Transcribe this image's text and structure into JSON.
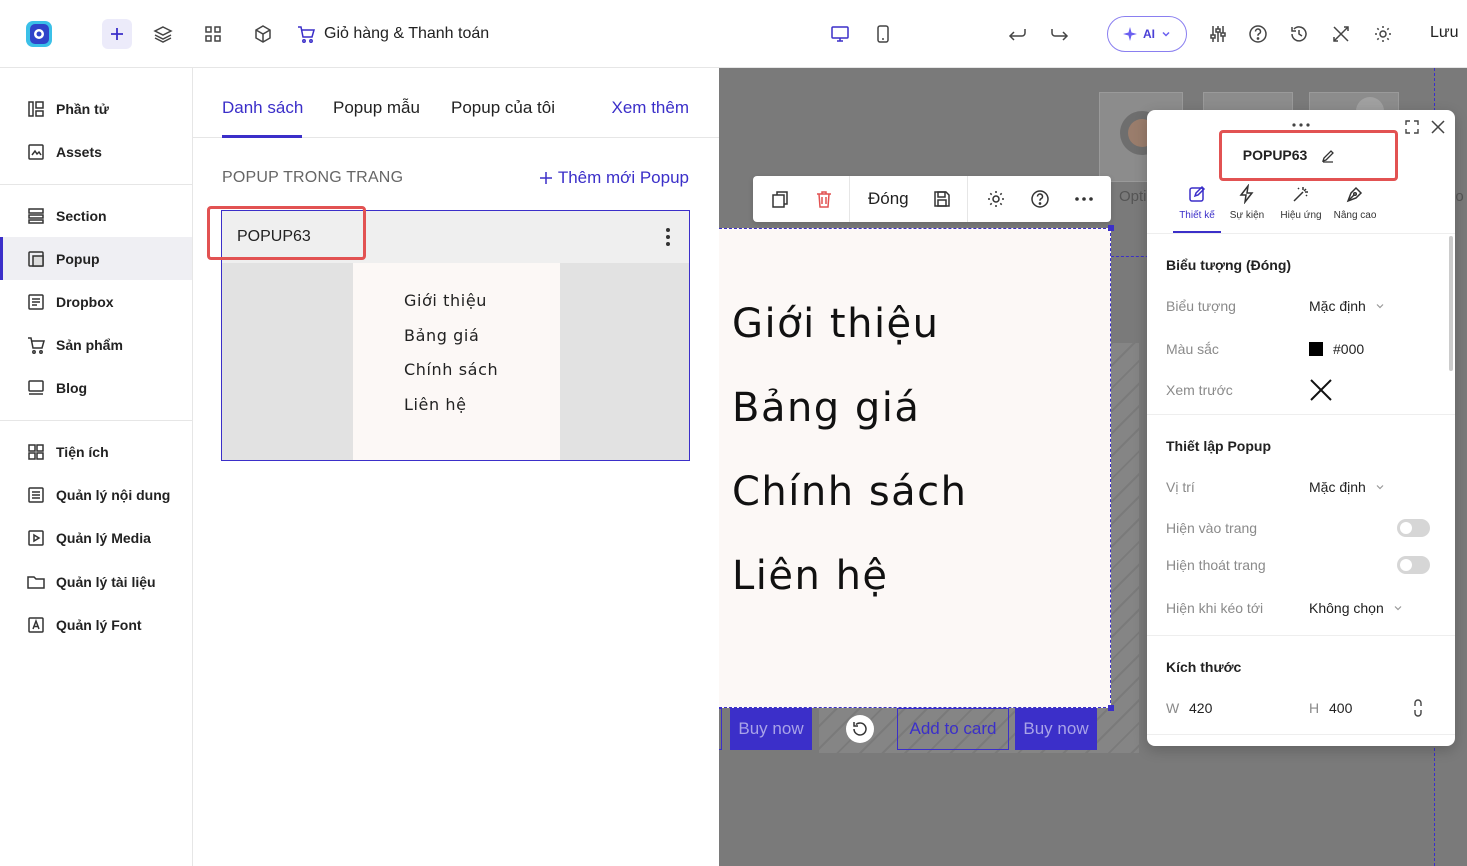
{
  "topbar": {
    "page_name": "Giỏ hàng & Thanh toán",
    "ai_label": "AI",
    "save_label": "Lưu"
  },
  "sidebar": {
    "items": [
      {
        "label": "Phần tử",
        "icon": "elements-icon"
      },
      {
        "label": "Assets",
        "icon": "assets-icon"
      },
      {
        "label": "Section",
        "icon": "section-icon"
      },
      {
        "label": "Popup",
        "icon": "popup-icon",
        "active": true
      },
      {
        "label": "Dropbox",
        "icon": "dropbox-icon"
      },
      {
        "label": "Sản phẩm",
        "icon": "cart-icon"
      },
      {
        "label": "Blog",
        "icon": "blog-icon"
      },
      {
        "label": "Tiện ích",
        "icon": "widgets-icon"
      },
      {
        "label": "Quản lý nội dung",
        "icon": "content-icon"
      },
      {
        "label": "Quản lý Media",
        "icon": "media-icon"
      },
      {
        "label": "Quản lý tài liệu",
        "icon": "folder-icon"
      },
      {
        "label": "Quản lý Font",
        "icon": "font-icon"
      }
    ]
  },
  "panel": {
    "tabs": [
      "Danh sách",
      "Popup mẫu",
      "Popup của tôi"
    ],
    "more_label": "Xem thêm",
    "section_label": "POPUP TRONG TRANG",
    "add_label": "Thêm mới Popup",
    "card": {
      "title": "POPUP63",
      "menu_items": [
        "Giới thiệu",
        "Bảng giá",
        "Chính sách",
        "Liên hệ"
      ]
    }
  },
  "canvas": {
    "toolbar": {
      "close_label": "Đóng"
    },
    "popup_items": [
      "Giới thiệu",
      "Bảng giá",
      "Chính sách",
      "Liên hệ"
    ],
    "buttons": {
      "buy_now": "Buy now",
      "add_to_card": "Add to card"
    },
    "partial_texts": {
      "left": "Opti",
      "right": "io"
    }
  },
  "props": {
    "title": "POPUP63",
    "tabs": [
      "Thiết kế",
      "Sự kiện",
      "Hiệu ứng",
      "Nâng cao"
    ],
    "icon_section": {
      "heading": "Biểu tượng (Đóng)",
      "icon_label": "Biểu tượng",
      "icon_value": "Mặc định",
      "color_label": "Màu sắc",
      "color_value": "#000",
      "preview_label": "Xem trước"
    },
    "popup_section": {
      "heading": "Thiết lập Popup",
      "position_label": "Vị trí",
      "position_value": "Mặc định",
      "show_enter_label": "Hiện vào trang",
      "show_exit_label": "Hiện thoát trang",
      "show_scroll_label": "Hiện khi kéo tới",
      "show_scroll_value": "Không chọn"
    },
    "size_section": {
      "heading": "Kích thước",
      "w_label": "W",
      "w_value": "420",
      "h_label": "H",
      "h_value": "400"
    }
  },
  "colors": {
    "accent": "#3b2fc9",
    "highlight": "#e25252",
    "canvas_bg": "#7a7a7a"
  }
}
